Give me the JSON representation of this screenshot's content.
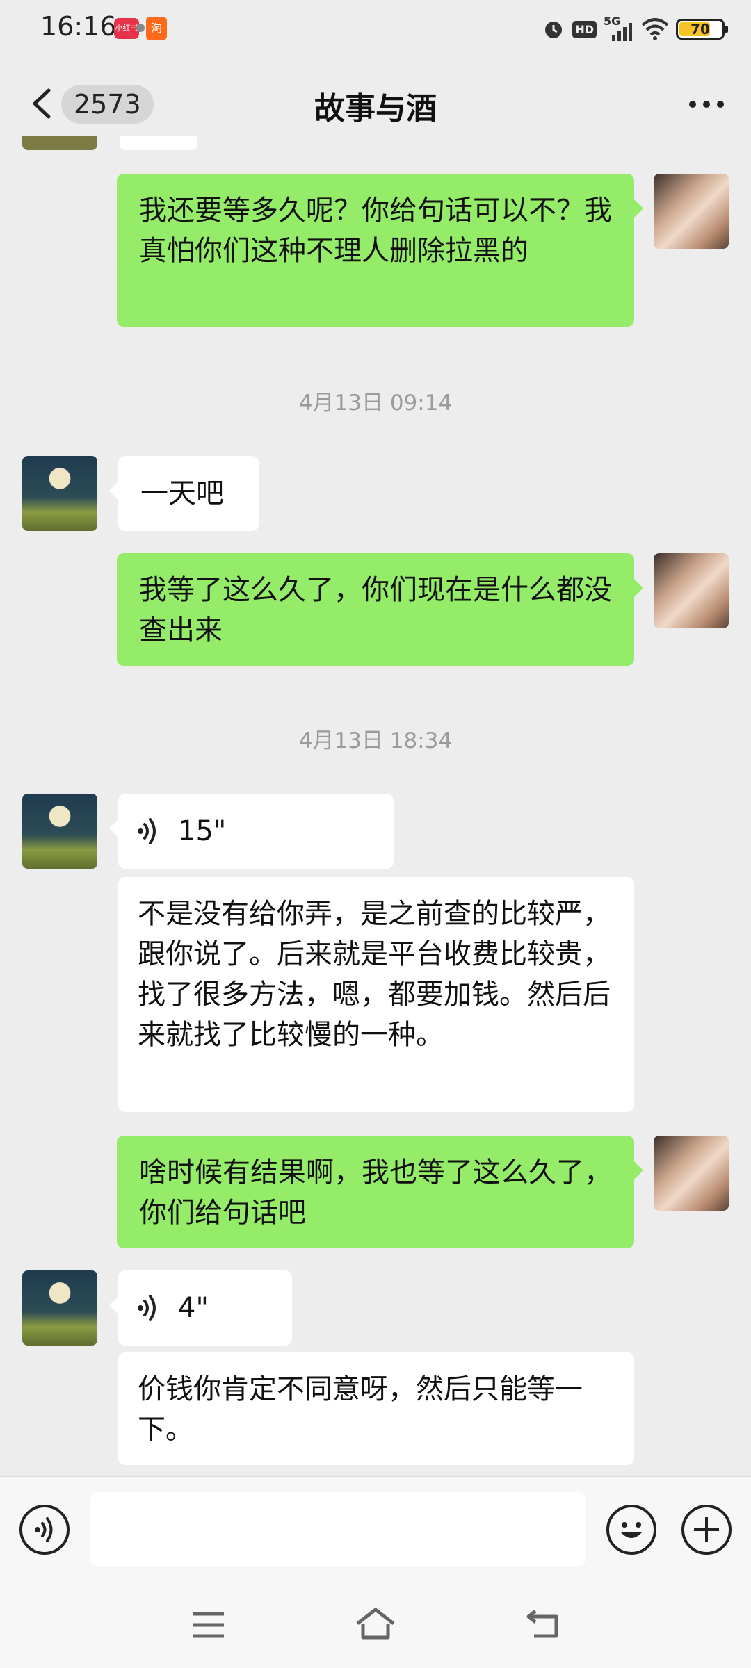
{
  "status_bar": {
    "time": "16:16",
    "app_badge_1": "小红书",
    "app_badge_2": "淘",
    "network": "5G",
    "hd": "HD",
    "battery": "70"
  },
  "header": {
    "back_icon": "chevron-left-icon",
    "unread_count": "2573",
    "title": "故事与酒",
    "more_icon": "more-dots-icon"
  },
  "messages": [
    {
      "sender": "me",
      "text": "我还要等多久呢？你给句话可以不？我真怕你们这种不理人删除拉黑的"
    },
    {
      "type": "timestamp",
      "text": "4月13日 09:14"
    },
    {
      "sender": "other",
      "text": "一天吧"
    },
    {
      "sender": "me",
      "text": "我等了这么久了，你们现在是什么都没查出来"
    },
    {
      "type": "timestamp",
      "text": "4月13日 18:34"
    },
    {
      "sender": "other",
      "type": "voice",
      "duration": "15\""
    },
    {
      "sender": "other",
      "type": "transcript",
      "text": "不是没有给你弄，是之前查的比较严，跟你说了。后来就是平台收费比较贵，找了很多方法，嗯，都要加钱。然后后来就找了比较慢的一种。"
    },
    {
      "sender": "me",
      "text": "啥时候有结果啊，我也等了这么久了，你们给句话吧"
    },
    {
      "sender": "other",
      "type": "voice",
      "duration": "4\""
    },
    {
      "sender": "other",
      "type": "transcript",
      "text": "价钱你肯定不同意呀，然后只能等一下。"
    }
  ],
  "input_bar": {
    "voice_icon": "voice-input-icon",
    "text_value": "",
    "emoji_icon": "emoji-icon",
    "plus_icon": "plus-icon"
  },
  "system_nav": {
    "menu_icon": "menu-icon",
    "home_icon": "home-icon",
    "back_icon": "back-icon"
  },
  "colors": {
    "background": "#ededed",
    "my_bubble": "#95ec69",
    "other_bubble": "#ffffff",
    "timestamp": "#9a9a9a"
  }
}
